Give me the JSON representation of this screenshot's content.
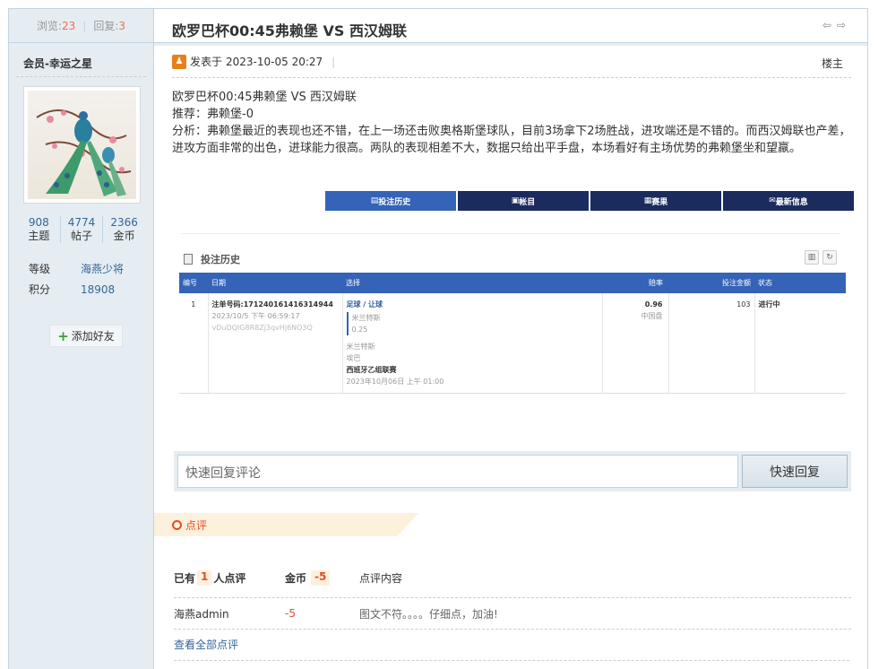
{
  "stats": {
    "views_label": "浏览:",
    "views": "23",
    "replies_label": "回复:",
    "replies": "3"
  },
  "user": {
    "name": "会员-幸运之星",
    "counts": [
      {
        "value": "908",
        "label": "主题"
      },
      {
        "value": "4774",
        "label": "帖子"
      },
      {
        "value": "2366",
        "label": "金币"
      }
    ],
    "level_label": "等级",
    "level": "海燕少将",
    "points_label": "积分",
    "points": "18908",
    "add_friend": "添加好友"
  },
  "post": {
    "title": "欧罗巴杯00:45弗赖堡 VS 西汉姆联",
    "posted_prefix": "发表于",
    "posted_at": "2023-10-05 20:27",
    "pipe": "|",
    "floor": "楼主",
    "lines": [
      "欧罗巴杯00:45弗赖堡 VS 西汉姆联",
      "推荐：弗赖堡-0",
      "分析：弗赖堡最近的表现也还不错，在上一场还击败奥格斯堡球队，目前3场拿下2场胜战，进攻端还是不错的。而西汉姆联也产差，进攻方面非常的出色，进球能力很高。两队的表现相差不大，数据只给出平手盘，本场看好有主场优势的弗赖堡坐和望羸。"
    ]
  },
  "bet_tabs": [
    {
      "label": "投注历史"
    },
    {
      "label": "帐目"
    },
    {
      "label": "赛果"
    },
    {
      "label": "最新信息"
    }
  ],
  "history": {
    "title": "投注历史",
    "headers": [
      "编号",
      "日期",
      "选择",
      "赔率",
      "投注金额",
      "状态"
    ],
    "row": {
      "num": "1",
      "order": "注单号码:171240161416314944",
      "time": "2023/10/5 下午 06:59:17",
      "code": "vDuDQIG8R8Zj3qvHj6NO3Q",
      "sel_type": "足球 / 让球",
      "sel_team": "米兰特斯",
      "sel_hcp": "0.25",
      "match_home": "米兰特斯",
      "match_away": "埃巴",
      "league": "西班牙乙组联赛",
      "match_time": "2023年10月06日 上午 01:00",
      "odds": "0.96",
      "odds_type": "中国盘",
      "stake": "103",
      "status": "进行中"
    }
  },
  "reply": {
    "placeholder": "快速回复评论",
    "button": "快速回复"
  },
  "ratings": {
    "title": "点评",
    "count_prefix": "已有",
    "count": "1",
    "count_suffix": "人点评",
    "coin_label": "金币",
    "coin_total": "-5",
    "content_label": "点评内容",
    "rows": [
      {
        "user": "海燕admin",
        "coin": "-5",
        "content": "图文不符。。。。仔细点，加油!"
      }
    ],
    "view_all": "查看全部点评"
  }
}
